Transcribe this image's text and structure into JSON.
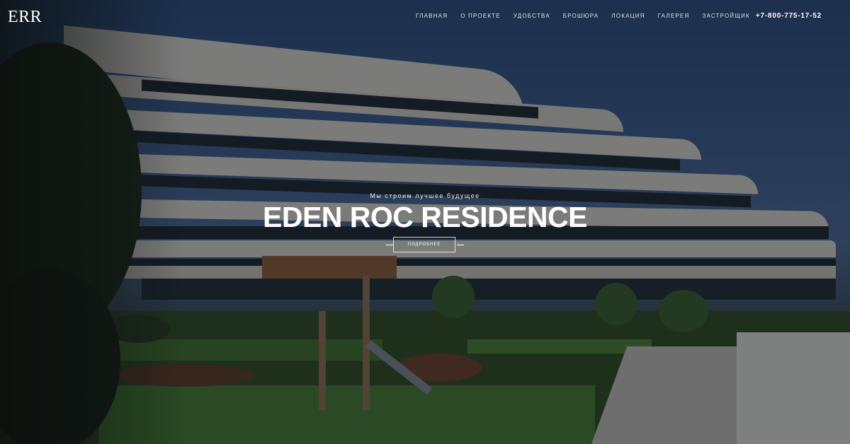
{
  "brand": {
    "logo": "ERR"
  },
  "nav": {
    "items": [
      "ГЛАВНАЯ",
      "О ПРОЕКТЕ",
      "УДОБСТВА",
      "БРОШЮРА",
      "ЛОКАЦИЯ",
      "ГАЛЕРЕЯ",
      "ЗАСТРОЙЩИК"
    ],
    "phone": "+7-800-775-17-52"
  },
  "hero": {
    "tagline": "Мы строим лучшее будущее",
    "title": "EDEN ROC RESIDENCE",
    "button_label": "ПОДРОБНЕЕ"
  },
  "colors": {
    "text": "#ffffff",
    "overlay": "rgba(8,12,18,0.42)"
  }
}
